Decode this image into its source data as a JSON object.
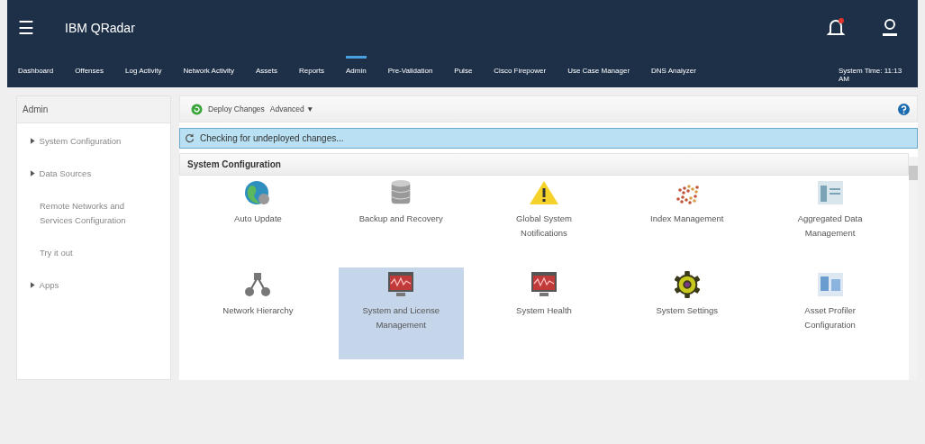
{
  "header": {
    "menu_icon": "☰",
    "title": "IBM QRadar"
  },
  "nav_tabs": [
    {
      "label": "Dashboard",
      "selected": false
    },
    {
      "label": "Offenses",
      "selected": false
    },
    {
      "label": "Log Activity",
      "selected": false
    },
    {
      "label": "Network Activity",
      "selected": false
    },
    {
      "label": "Assets",
      "selected": false
    },
    {
      "label": "Reports",
      "selected": false
    },
    {
      "label": "Admin",
      "selected": true
    },
    {
      "label": "Pre-Validation",
      "selected": false
    },
    {
      "label": "Pulse",
      "selected": false
    },
    {
      "label": "Cisco Firepower",
      "selected": false
    },
    {
      "label": "Use Case Manager",
      "selected": false
    },
    {
      "label": "DNS Analyzer",
      "selected": false
    }
  ],
  "system_time": "System Time: 11:13 AM",
  "sidebar": {
    "title": "Admin",
    "items": [
      {
        "label": "System Configuration",
        "expanded": false,
        "kind": "group"
      },
      {
        "label": "Data Sources",
        "expanded": false,
        "kind": "group"
      },
      {
        "label": "Remote Networks and Services Configuration",
        "kind": "link"
      },
      {
        "label": "Try it out",
        "kind": "link"
      },
      {
        "label": "Apps",
        "expanded": false,
        "kind": "group"
      }
    ]
  },
  "toolbar": {
    "deploy": "Deploy Changes",
    "advanced": "Advanced ▼"
  },
  "status_message": "Checking for undeployed changes...",
  "section_title": "System Configuration",
  "tiles": [
    {
      "label": "Auto Update",
      "kind": "globe",
      "selected": false
    },
    {
      "label": "Backup and Recovery",
      "kind": "database",
      "selected": false
    },
    {
      "label": "Global System Notifications",
      "kind": "warning",
      "selected": false
    },
    {
      "label": "Index Management",
      "kind": "dots",
      "selected": false
    },
    {
      "label": "Aggregated Data Management",
      "kind": "data",
      "selected": false
    },
    {
      "label": "Network Hierarchy",
      "kind": "network",
      "selected": false
    },
    {
      "label": "System and License Management",
      "kind": "monitor",
      "selected": true
    },
    {
      "label": "System Health",
      "kind": "monitor",
      "selected": false
    },
    {
      "label": "System Settings",
      "kind": "gear",
      "selected": false
    },
    {
      "label": "Asset Profiler Configuration",
      "kind": "servers",
      "selected": false
    }
  ]
}
